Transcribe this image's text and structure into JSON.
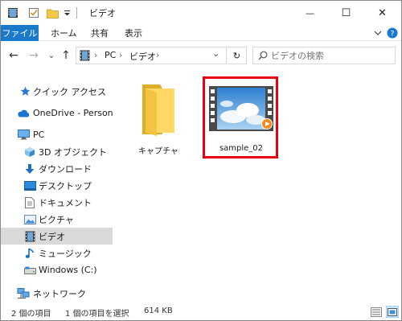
{
  "window": {
    "title": "ビデオ",
    "minimize_glyph": "—",
    "maximize_glyph": "☐",
    "close_glyph": "✕"
  },
  "quick_access_toolbar": {
    "icons": [
      "film-icon",
      "properties-checkbox-icon",
      "new-folder-icon",
      "dropdown-arrow-icon"
    ]
  },
  "ribbon": {
    "tabs": [
      "ファイル",
      "ホーム",
      "共有",
      "表示"
    ],
    "file_tab_color": "#1979ca"
  },
  "address": {
    "back_glyph": "←",
    "forward_glyph": "→",
    "recent_glyph": "⌄",
    "up_glyph": "↑",
    "crumbs": [
      "PC",
      "ビデオ"
    ],
    "separator": "›",
    "dropdown_glyph": "⌄",
    "refresh_glyph": "↻"
  },
  "search": {
    "placeholder": "ビデオの検索"
  },
  "nav": {
    "quick_access": "クイック アクセス",
    "onedrive": "OneDrive - Personal",
    "pc": "PC",
    "items": [
      {
        "label": "3D オブジェクト",
        "icon": "3d-objects-icon"
      },
      {
        "label": "ダウンロード",
        "icon": "download-arrow-icon"
      },
      {
        "label": "デスクトップ",
        "icon": "desktop-icon"
      },
      {
        "label": "ドキュメント",
        "icon": "document-icon"
      },
      {
        "label": "ピクチャ",
        "icon": "pictures-icon"
      },
      {
        "label": "ビデオ",
        "icon": "video-icon"
      },
      {
        "label": "ミュージック",
        "icon": "music-note-icon"
      },
      {
        "label": "Windows (C:)",
        "icon": "drive-icon"
      }
    ],
    "network": "ネットワーク",
    "selected_bg": "#d9d9d9"
  },
  "files": [
    {
      "name": "キャプチャ",
      "type": "folder"
    },
    {
      "name": "sample_02",
      "type": "video"
    }
  ],
  "highlight_color": "#e60012",
  "status": {
    "item_count": "2 個の項目",
    "selection": "1 個の項目を選択",
    "size": "614 KB"
  }
}
